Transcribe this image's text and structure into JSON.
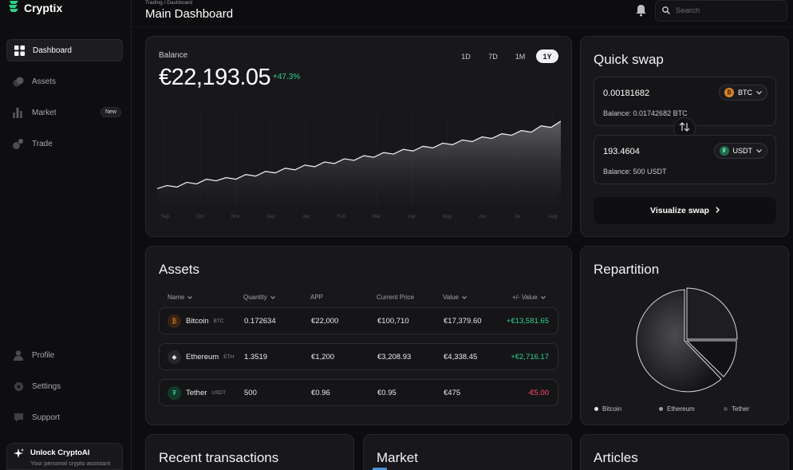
{
  "app": {
    "name": "Cryptix"
  },
  "sidebar": {
    "items": [
      {
        "label": "Dashboard",
        "icon": "grid-icon",
        "active": true
      },
      {
        "label": "Assets",
        "icon": "coins-icon"
      },
      {
        "label": "Market",
        "icon": "bar-chart-icon",
        "badge": "New"
      },
      {
        "label": "Trade",
        "icon": "trade-icon"
      }
    ],
    "bottom_items": [
      {
        "label": "Profile",
        "icon": "user-icon"
      },
      {
        "label": "Settings",
        "icon": "gear-icon"
      },
      {
        "label": "Support",
        "icon": "support-icon"
      }
    ],
    "unlock": {
      "title": "Unlock CryptoAI",
      "subtitle": "Your personal crypto assistant"
    }
  },
  "header": {
    "breadcrumb": "Trading / Dashboard",
    "title": "Main Dashboard",
    "search_placeholder": "Search"
  },
  "balance": {
    "label": "Balance",
    "value": "€22,193.05",
    "change": "+47.3%",
    "periods": [
      "1D",
      "7D",
      "1M",
      "1Y"
    ],
    "active_period": "1Y",
    "months": [
      "Sep",
      "Oct",
      "Nov",
      "Dec",
      "Jan",
      "Feb",
      "Mar",
      "Apr",
      "May",
      "Jun",
      "Jul",
      "Aug"
    ]
  },
  "chart_data": {
    "type": "area",
    "title": "",
    "x": [
      "Sep",
      "Oct",
      "Nov",
      "Dec",
      "Jan",
      "Feb",
      "Mar",
      "Apr",
      "May",
      "Jun",
      "Jul",
      "Aug"
    ],
    "series": [
      {
        "values": [
          12,
          14,
          13,
          16,
          15,
          18,
          17,
          19,
          18,
          21,
          20,
          23,
          22,
          25,
          24,
          27,
          26,
          29,
          28,
          31,
          30,
          33,
          32,
          35,
          34,
          37,
          36,
          39,
          38,
          41,
          40,
          43,
          42,
          45,
          44,
          47,
          46,
          49,
          48,
          52,
          51,
          55
        ]
      }
    ],
    "xlabel": "",
    "ylabel": "",
    "grid": true
  },
  "quick_swap": {
    "title": "Quick swap",
    "from": {
      "amount": "0.00181682",
      "token": "BTC",
      "balance": "Balance: 0.01742682 BTC"
    },
    "to": {
      "amount": "193.4604",
      "token": "USDT",
      "balance": "Balance: 500 USDT"
    },
    "button_label": "Visualize swap"
  },
  "assets": {
    "title": "Assets",
    "columns": [
      "Name",
      "Quantity",
      "APP",
      "Current Price",
      "Value",
      "+/- Value"
    ],
    "rows": [
      {
        "name": "Bitcoin",
        "symbol": "BTC",
        "quantity": "0.172634",
        "app": "€22,000",
        "price": "€100,710",
        "value": "€17,379.60",
        "change": "+€13,581.65",
        "positive": true
      },
      {
        "name": "Ethereum",
        "symbol": "ETH",
        "quantity": "1.3519",
        "app": "€1,200",
        "price": "€3,208.93",
        "value": "€4,338.45",
        "change": "+€2,716.17",
        "positive": true
      },
      {
        "name": "Tether",
        "symbol": "USDT",
        "quantity": "500",
        "app": "€0.96",
        "price": "€0.95",
        "value": "€475",
        "change": "-€5.00",
        "positive": false
      }
    ]
  },
  "repartition": {
    "title": "Repartition",
    "legend": [
      "Bitcoin",
      "Ethereum",
      "Tether"
    ]
  },
  "bottom_cards": {
    "recent": "Recent transactions",
    "market": "Market",
    "articles": "Articles"
  },
  "colors": {
    "positive": "#2fd18a",
    "negative": "#ff4d6a",
    "bg": "#0d0d10",
    "card": "#18181c"
  }
}
